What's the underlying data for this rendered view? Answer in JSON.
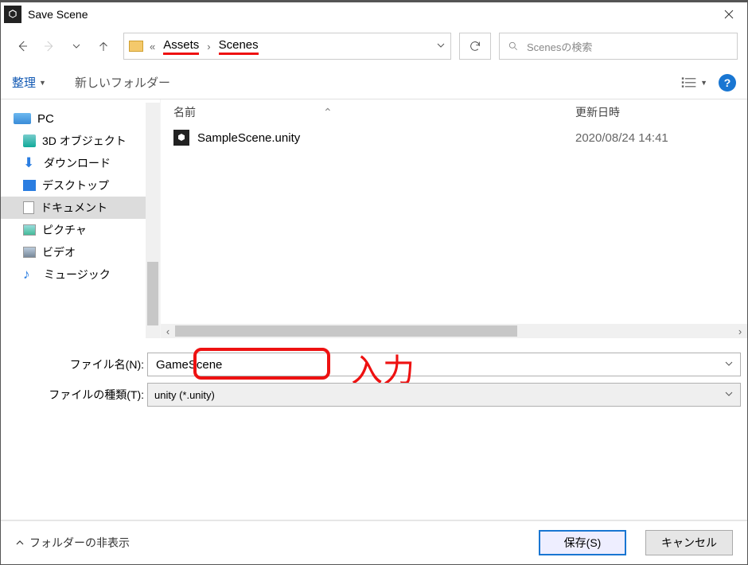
{
  "title": "Save Scene",
  "breadcrumb": {
    "sep": "«",
    "part1": "Assets",
    "part2": "Scenes"
  },
  "search_placeholder": "Scenesの検索",
  "toolbar": {
    "organize": "整理",
    "newfolder": "新しいフォルダー"
  },
  "sidebar": {
    "pc": "PC",
    "items": [
      {
        "label": "3D オブジェクト"
      },
      {
        "label": "ダウンロード"
      },
      {
        "label": "デスクトップ"
      },
      {
        "label": "ドキュメント"
      },
      {
        "label": "ピクチャ"
      },
      {
        "label": "ビデオ"
      },
      {
        "label": "ミュージック"
      }
    ]
  },
  "columns": {
    "name": "名前",
    "date": "更新日時"
  },
  "files": [
    {
      "name": "SampleScene.unity",
      "date": "2020/08/24 14:41"
    }
  ],
  "form": {
    "filename_label": "ファイル名(N):",
    "filename_value": "GameScene",
    "filetype_label": "ファイルの種類(T):",
    "filetype_value": "unity (*.unity)"
  },
  "annotation": "入力",
  "footer": {
    "hide": "フォルダーの非表示",
    "save": "保存(S)",
    "cancel": "キャンセル"
  }
}
